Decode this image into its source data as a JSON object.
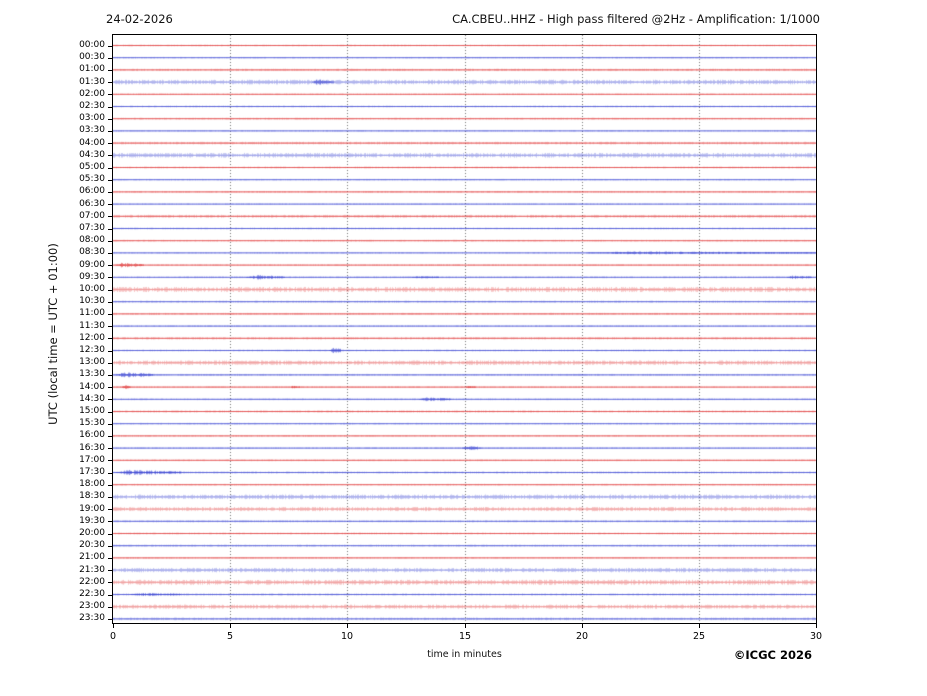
{
  "header": {
    "date": "24-02-2026",
    "title": "CA.CBEU..HHZ - High pass filtered @2Hz - Amplification: 1/1000"
  },
  "footer": {
    "copyright": "©ICGC 2026"
  },
  "chart_data": {
    "type": "line",
    "variant": "helicorder-seismogram",
    "title": "CA.CBEU..HHZ - High pass filtered @2Hz - Amplification: 1/1000",
    "date": "24-02-2026",
    "xlabel": "time in minutes",
    "ylabel": "UTC (local time = UTC + 01:00)",
    "x_range": [
      0,
      30
    ],
    "x_ticks": [
      0,
      5,
      10,
      15,
      20,
      25,
      30
    ],
    "grid": "vertical dotted gridlines every 5 minutes",
    "legend": "none",
    "trace_colors": {
      "red": "#dd2b2b",
      "blue": "#2f3bd0"
    },
    "grid_color": "#666666",
    "rows": [
      {
        "label": "00:00",
        "color": "red",
        "noise": 0.55,
        "events": []
      },
      {
        "label": "00:30",
        "color": "blue",
        "noise": 0.55,
        "events": []
      },
      {
        "label": "01:00",
        "color": "red",
        "noise": 0.8,
        "events": []
      },
      {
        "label": "01:30",
        "color": "blue",
        "noise": 1.6,
        "events": [
          {
            "start": 8.5,
            "end": 9.4,
            "amp": 2.0
          }
        ]
      },
      {
        "label": "02:00",
        "color": "red",
        "noise": 0.55,
        "events": []
      },
      {
        "label": "02:30",
        "color": "blue",
        "noise": 0.6,
        "events": []
      },
      {
        "label": "03:00",
        "color": "red",
        "noise": 0.65,
        "events": []
      },
      {
        "label": "03:30",
        "color": "blue",
        "noise": 0.55,
        "events": []
      },
      {
        "label": "04:00",
        "color": "red",
        "noise": 0.9,
        "events": []
      },
      {
        "label": "04:30",
        "color": "blue",
        "noise": 1.6,
        "events": []
      },
      {
        "label": "05:00",
        "color": "red",
        "noise": 0.6,
        "events": []
      },
      {
        "label": "05:30",
        "color": "blue",
        "noise": 0.55,
        "events": []
      },
      {
        "label": "06:00",
        "color": "red",
        "noise": 0.65,
        "events": []
      },
      {
        "label": "06:30",
        "color": "blue",
        "noise": 0.55,
        "events": []
      },
      {
        "label": "07:00",
        "color": "red",
        "noise": 1.0,
        "events": []
      },
      {
        "label": "07:30",
        "color": "blue",
        "noise": 0.6,
        "events": []
      },
      {
        "label": "08:00",
        "color": "red",
        "noise": 0.6,
        "events": []
      },
      {
        "label": "08:30",
        "color": "blue",
        "noise": 0.55,
        "events": [
          {
            "start": 20.3,
            "end": 30,
            "amp": 1.1
          }
        ]
      },
      {
        "label": "09:00",
        "color": "red",
        "noise": 0.6,
        "events": [
          {
            "start": 0.15,
            "end": 1.3,
            "amp": 1.9
          }
        ]
      },
      {
        "label": "09:30",
        "color": "blue",
        "noise": 0.6,
        "events": [
          {
            "start": 5.7,
            "end": 7.3,
            "amp": 1.7
          },
          {
            "start": 12.8,
            "end": 13.9,
            "amp": 1.0
          },
          {
            "start": 28.8,
            "end": 29.8,
            "amp": 1.4
          }
        ]
      },
      {
        "label": "10:00",
        "color": "red",
        "noise": 1.7,
        "events": []
      },
      {
        "label": "10:30",
        "color": "blue",
        "noise": 0.7,
        "events": []
      },
      {
        "label": "11:00",
        "color": "red",
        "noise": 0.7,
        "events": []
      },
      {
        "label": "11:30",
        "color": "blue",
        "noise": 0.6,
        "events": []
      },
      {
        "label": "12:00",
        "color": "red",
        "noise": 0.8,
        "events": []
      },
      {
        "label": "12:30",
        "color": "blue",
        "noise": 0.6,
        "events": [
          {
            "start": 9.25,
            "end": 9.7,
            "amp": 2.4
          }
        ]
      },
      {
        "label": "13:00",
        "color": "red",
        "noise": 1.5,
        "events": []
      },
      {
        "label": "13:30",
        "color": "blue",
        "noise": 0.7,
        "events": [
          {
            "start": 0.15,
            "end": 1.7,
            "amp": 2.0
          }
        ]
      },
      {
        "label": "14:00",
        "color": "red",
        "noise": 0.6,
        "events": [
          {
            "start": 0.4,
            "end": 0.75,
            "amp": 1.6
          },
          {
            "start": 7.6,
            "end": 7.95,
            "amp": 1.3
          },
          {
            "start": 15.1,
            "end": 15.45,
            "amp": 1.2
          }
        ]
      },
      {
        "label": "14:30",
        "color": "blue",
        "noise": 0.6,
        "events": [
          {
            "start": 13.1,
            "end": 14.4,
            "amp": 1.5
          }
        ]
      },
      {
        "label": "15:00",
        "color": "red",
        "noise": 0.7,
        "events": []
      },
      {
        "label": "15:30",
        "color": "blue",
        "noise": 0.6,
        "events": []
      },
      {
        "label": "16:00",
        "color": "red",
        "noise": 0.6,
        "events": []
      },
      {
        "label": "16:30",
        "color": "blue",
        "noise": 0.6,
        "events": [
          {
            "start": 14.9,
            "end": 15.7,
            "amp": 1.7
          }
        ]
      },
      {
        "label": "17:00",
        "color": "red",
        "noise": 0.6,
        "events": []
      },
      {
        "label": "17:30",
        "color": "blue",
        "noise": 0.7,
        "events": [
          {
            "start": 0.15,
            "end": 2.9,
            "amp": 1.9
          }
        ]
      },
      {
        "label": "18:00",
        "color": "red",
        "noise": 0.6,
        "events": []
      },
      {
        "label": "18:30",
        "color": "blue",
        "noise": 1.6,
        "events": []
      },
      {
        "label": "19:00",
        "color": "red",
        "noise": 1.4,
        "events": []
      },
      {
        "label": "19:30",
        "color": "blue",
        "noise": 0.7,
        "events": []
      },
      {
        "label": "20:00",
        "color": "red",
        "noise": 0.6,
        "events": []
      },
      {
        "label": "20:30",
        "color": "blue",
        "noise": 0.7,
        "events": []
      },
      {
        "label": "21:00",
        "color": "red",
        "noise": 0.6,
        "events": []
      },
      {
        "label": "21:30",
        "color": "blue",
        "noise": 1.5,
        "events": []
      },
      {
        "label": "22:00",
        "color": "red",
        "noise": 1.7,
        "events": []
      },
      {
        "label": "22:30",
        "color": "blue",
        "noise": 0.7,
        "events": [
          {
            "start": 0.8,
            "end": 2.9,
            "amp": 1.3
          }
        ]
      },
      {
        "label": "23:00",
        "color": "red",
        "noise": 1.4,
        "events": []
      },
      {
        "label": "23:30",
        "color": "blue",
        "noise": 0.9,
        "events": []
      }
    ]
  }
}
